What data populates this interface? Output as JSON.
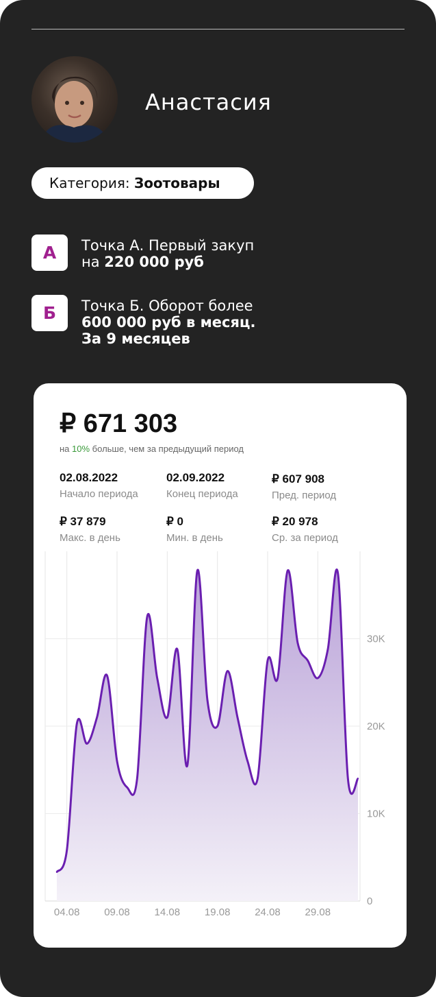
{
  "profile": {
    "name": "Анастасия",
    "category_label": "Категория: ",
    "category_value": "Зоотовары"
  },
  "points": [
    {
      "badge": "А",
      "line1": "Точка А. Первый закуп",
      "line2_prefix": "на ",
      "line2_bold": "220 000 руб"
    },
    {
      "badge": "Б",
      "line1": "Точка Б. Оборот более",
      "line2_bold": "600 000 руб в месяц.",
      "line3_bold": "За 9 месяцев"
    }
  ],
  "stats": {
    "total": "₽ 671 303",
    "note_prefix": "на ",
    "note_pct": "10%",
    "note_suffix": " больше, чем за предыдущий период",
    "items": [
      {
        "value": "02.08.2022",
        "label": "Начало периода"
      },
      {
        "value": "02.09.2022",
        "label": "Конец периода"
      },
      {
        "value": "₽ 607 908",
        "label": "Пред. период"
      },
      {
        "value": "₽ 37 879",
        "label": "Макс. в день"
      },
      {
        "value": "₽ 0",
        "label": "Мин. в день"
      },
      {
        "value": "₽ 20 978",
        "label": "Ср. за период"
      }
    ]
  },
  "colors": {
    "line": "#6a1fb0",
    "area_top": "#b9a2d8",
    "area_bottom": "#f4f1f8",
    "badge_text": "#a0208f",
    "positive": "#3a9a3a"
  },
  "chart_data": {
    "type": "area",
    "xlabel": "",
    "ylabel": "",
    "x_tick_labels": [
      "04.08",
      "09.08",
      "14.08",
      "19.08",
      "24.08",
      "29.08"
    ],
    "y_tick_labels": [
      "0",
      "10K",
      "20K",
      "30K"
    ],
    "ylim": [
      0,
      40000
    ],
    "grid": true,
    "x": [
      "03.08",
      "04.08",
      "05.08",
      "06.08",
      "07.08",
      "08.08",
      "09.08",
      "10.08",
      "11.08",
      "12.08",
      "13.08",
      "14.08",
      "15.08",
      "16.08",
      "17.08",
      "18.08",
      "19.08",
      "20.08",
      "21.08",
      "22.08",
      "23.08",
      "24.08",
      "25.08",
      "26.08",
      "27.08",
      "28.08",
      "29.08",
      "30.08",
      "31.08",
      "01.09",
      "02.09"
    ],
    "values": [
      3300,
      5800,
      20300,
      18000,
      21000,
      25800,
      16000,
      13000,
      14000,
      32500,
      25500,
      21000,
      28800,
      15500,
      37800,
      23000,
      20000,
      26300,
      21000,
      16000,
      14000,
      27500,
      25500,
      37800,
      29500,
      27500,
      25500,
      28800,
      37500,
      14000,
      14000
    ]
  }
}
